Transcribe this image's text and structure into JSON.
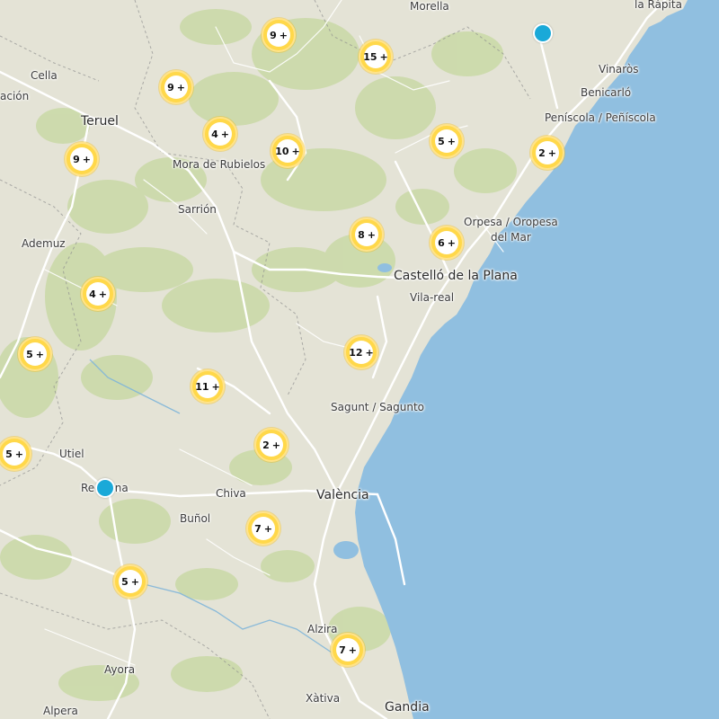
{
  "map": {
    "colors": {
      "land": "#e4e3d6",
      "sea": "#90bfe0",
      "forest": "#c9d9a6",
      "road": "#ffffff",
      "cluster_ring": "#ffd84a",
      "single_marker": "#1aa9d8"
    },
    "places": [
      {
        "id": "morella",
        "label": "Morella",
        "cls": "place"
      },
      {
        "id": "la-rapita",
        "label": "la Ràpita",
        "cls": "place"
      },
      {
        "id": "cella",
        "label": "Cella",
        "cls": "place"
      },
      {
        "id": "vinaros",
        "label": "Vinaròs",
        "cls": "place"
      },
      {
        "id": "benicarlo",
        "label": "Benicarló",
        "cls": "place"
      },
      {
        "id": "peniscola",
        "label": "Peníscola / Peñíscola",
        "cls": "place"
      },
      {
        "id": "teruel",
        "label": "Teruel",
        "cls": "place major"
      },
      {
        "id": "acin",
        "label": "ación",
        "cls": "place"
      },
      {
        "id": "mora",
        "label": "Mora de Rubielos",
        "cls": "place"
      },
      {
        "id": "sarrion",
        "label": "Sarrión",
        "cls": "place"
      },
      {
        "id": "ademuz",
        "label": "Ademuz",
        "cls": "place"
      },
      {
        "id": "orpesa1",
        "label": "Orpesa / Oropesa",
        "cls": "place"
      },
      {
        "id": "orpesa2",
        "label": "del Mar",
        "cls": "place"
      },
      {
        "id": "castello",
        "label": "Castelló de la Plana",
        "cls": "place major"
      },
      {
        "id": "vilareal",
        "label": "Vila-real",
        "cls": "place"
      },
      {
        "id": "sagunt",
        "label": "Sagunt / Sagunto",
        "cls": "place"
      },
      {
        "id": "utiel",
        "label": "Utiel",
        "cls": "place"
      },
      {
        "id": "requena",
        "label": "Requena",
        "cls": "place"
      },
      {
        "id": "chiva",
        "label": "Chiva",
        "cls": "place"
      },
      {
        "id": "valencia",
        "label": "València",
        "cls": "place major"
      },
      {
        "id": "bunol",
        "label": "Buñol",
        "cls": "place"
      },
      {
        "id": "alzira",
        "label": "Alzira",
        "cls": "place"
      },
      {
        "id": "ayora",
        "label": "Ayora",
        "cls": "place"
      },
      {
        "id": "xativa",
        "label": "Xàtiva",
        "cls": "place"
      },
      {
        "id": "alpera",
        "label": "Alpera",
        "cls": "place"
      },
      {
        "id": "gandia",
        "label": "Gandia",
        "cls": "place major"
      }
    ],
    "clusters": [
      {
        "id": "c1",
        "count": "9",
        "plus": "+"
      },
      {
        "id": "c2",
        "count": "15",
        "plus": "+"
      },
      {
        "id": "c3",
        "count": "9",
        "plus": "+"
      },
      {
        "id": "c4",
        "count": "4",
        "plus": "+"
      },
      {
        "id": "c5",
        "count": "10",
        "plus": "+"
      },
      {
        "id": "c6",
        "count": "9",
        "plus": "+"
      },
      {
        "id": "c7",
        "count": "5",
        "plus": "+"
      },
      {
        "id": "c8",
        "count": "2",
        "plus": "+"
      },
      {
        "id": "c9",
        "count": "8",
        "plus": "+"
      },
      {
        "id": "c10",
        "count": "6",
        "plus": "+"
      },
      {
        "id": "c11",
        "count": "4",
        "plus": "+"
      },
      {
        "id": "c12",
        "count": "5",
        "plus": "+"
      },
      {
        "id": "c13",
        "count": "12",
        "plus": "+"
      },
      {
        "id": "c14",
        "count": "11",
        "plus": "+"
      },
      {
        "id": "c15",
        "count": "5",
        "plus": "+"
      },
      {
        "id": "c16",
        "count": "2",
        "plus": "+"
      },
      {
        "id": "c17",
        "count": "7",
        "plus": "+"
      },
      {
        "id": "c18",
        "count": "5",
        "plus": "+"
      },
      {
        "id": "c19",
        "count": "7",
        "plus": "+"
      }
    ],
    "singles": [
      {
        "id": "s1",
        "icon": "location-marker-icon"
      },
      {
        "id": "s2",
        "icon": "location-marker-icon"
      }
    ]
  }
}
